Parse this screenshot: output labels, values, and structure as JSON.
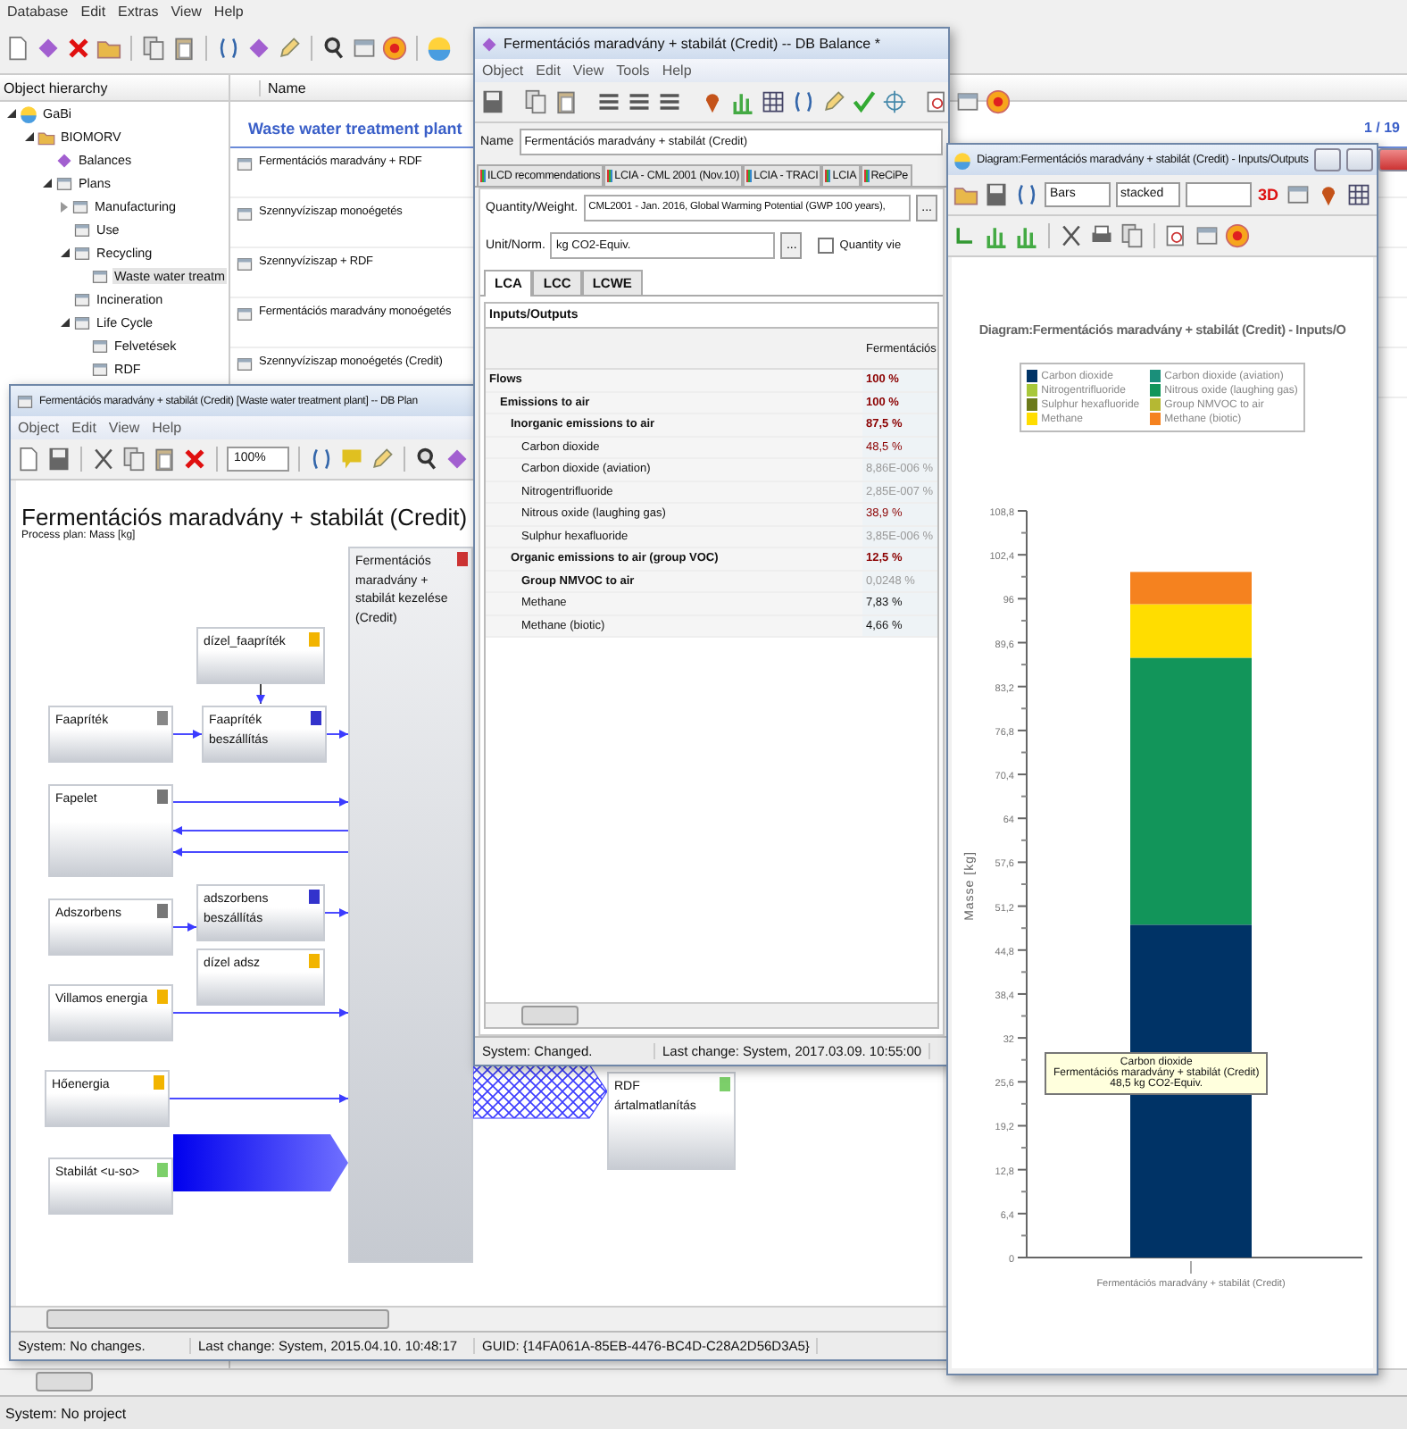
{
  "main": {
    "menu": [
      "Database",
      "Edit",
      "Extras",
      "View",
      "Help"
    ],
    "hierarchy_header": "Object hierarchy",
    "tree": [
      {
        "label": "GaBi",
        "kind": "root",
        "expanded": true,
        "selected": false,
        "children": [
          {
            "label": "BIOMORV",
            "kind": "database",
            "expanded": true,
            "selected": false,
            "children": [
              {
                "label": "Balances",
                "kind": "balance",
                "selected": false
              },
              {
                "label": "Plans",
                "kind": "plan",
                "expanded": true,
                "selected": false,
                "children": [
                  {
                    "label": "Manufacturing",
                    "kind": "plan",
                    "expanded": false,
                    "selected": false
                  },
                  {
                    "label": "Use",
                    "kind": "plan",
                    "selected": false
                  },
                  {
                    "label": "Recycling",
                    "kind": "plan",
                    "expanded": true,
                    "selected": false,
                    "children": [
                      {
                        "label": "Waste water treatm",
                        "kind": "plan",
                        "selected": true
                      }
                    ]
                  },
                  {
                    "label": "Incineration",
                    "kind": "plan",
                    "selected": false
                  },
                  {
                    "label": "Life Cycle",
                    "kind": "plan",
                    "expanded": true,
                    "selected": false,
                    "children": [
                      {
                        "label": "Felvetések",
                        "kind": "plan",
                        "selected": false
                      },
                      {
                        "label": "RDF",
                        "kind": "plan",
                        "selected": false
                      }
                    ]
                  }
                ]
              }
            ]
          }
        ]
      }
    ],
    "name_header": "Name",
    "group": "Waste water treatment plant",
    "page": "1 / 19",
    "items": [
      "Fermentációs maradvány + RDF",
      "Szennyvíziszap monoégetés",
      "Szennyvíziszap + RDF",
      "Fermentációs maradvány monoégetés",
      "Szennyvíziszap monoégetés (Credit)"
    ],
    "status": "System: No project"
  },
  "plan": {
    "title": "Fermentációs maradvány + stabilát (Credit) [Waste water treatment plant] -- DB Plan",
    "menu": [
      "Object",
      "Edit",
      "View",
      "Help"
    ],
    "zoom": "100%",
    "heading": "Fermentációs maradvány + stabilát (Credit)",
    "subheading": "Process plan: Mass [kg]",
    "nodes": [
      {
        "label": "dízel_faapríték",
        "kind": "process"
      },
      {
        "label": "Faapríték",
        "kind": "link"
      },
      {
        "label": "Faapríték beszállítás",
        "kind": "partner"
      },
      {
        "label": "Fapelet",
        "kind": "plan"
      },
      {
        "label": "Adszorbens",
        "kind": "plan"
      },
      {
        "label": "adszorbens beszállítás",
        "kind": "partner"
      },
      {
        "label": "dízel adsz",
        "kind": "process"
      },
      {
        "label": "Villamos energia",
        "kind": "process"
      },
      {
        "label": "Hőenergia",
        "kind": "process"
      },
      {
        "label": "Stabilát <u-so>",
        "kind": "output"
      },
      {
        "label": "Fermentációs maradvány + stabilát kezelése (Credit)",
        "kind": "main"
      },
      {
        "label": "RDF ártalmatlanítás",
        "kind": "output"
      }
    ],
    "status": [
      "System: No changes.",
      "Last change: System, 2015.04.10. 10:48:17",
      "GUID: {14FA061A-85EB-4476-BC4D-C28A2D56D3A5}"
    ]
  },
  "balance": {
    "title": "Fermentációs maradvány + stabilát (Credit) -- DB Balance *",
    "menu": [
      "Object",
      "Edit",
      "View",
      "Tools",
      "Help"
    ],
    "name_label": "Name",
    "name_value": "Fermentációs maradvány + stabilát (Credit)",
    "tabs": [
      {
        "label": "ILCD recommendations",
        "selected": false
      },
      {
        "label": "LCIA - CML 2001 (Nov.10)",
        "selected": false
      },
      {
        "label": "LCIA - TRACI",
        "selected": false
      },
      {
        "label": "LCIA",
        "selected": false
      },
      {
        "label": "ReCiPe",
        "selected": false
      }
    ],
    "quantity_label": "Quantity/Weight.",
    "quantity_value": "CML2001 - Jan. 2016, Global Warming Potential (GWP 100 years),",
    "quantity_browse": "...",
    "quantity_view": {
      "label": "Quantity vie",
      "checked": false
    },
    "unit_label": "Unit/Norm.",
    "unit_value": "kg CO2-Equiv.",
    "unit_browse": "...",
    "subtabs": [
      {
        "label": "LCA",
        "selected": true
      },
      {
        "label": "LCC",
        "selected": false
      },
      {
        "label": "LCWE",
        "selected": false
      }
    ],
    "section": "Inputs/Outputs",
    "column": "Fermentációs",
    "rows": [
      {
        "label": "Flows",
        "kind": "group",
        "value": "100 %",
        "color": "#8b0000",
        "children": [
          {
            "label": "Emissions to air",
            "kind": "group",
            "value": "100 %",
            "color": "#8b0000",
            "children": [
              {
                "label": "Inorganic emissions to air",
                "kind": "group",
                "value": "87,5 %",
                "color": "#8b0000",
                "children": [
                  {
                    "label": "Carbon dioxide",
                    "kind": "flow",
                    "value": "48,5 %",
                    "color": "#8b0000"
                  },
                  {
                    "label": "Carbon dioxide (aviation)",
                    "kind": "flow",
                    "value": "8,86E-006 %",
                    "color": "#9a9a9a"
                  },
                  {
                    "label": "Nitrogentrifluoride",
                    "kind": "flow",
                    "value": "2,85E-007 %",
                    "color": "#9a9a9a"
                  },
                  {
                    "label": "Nitrous oxide (laughing gas)",
                    "kind": "flow",
                    "value": "38,9 %",
                    "color": "#8b0000"
                  },
                  {
                    "label": "Sulphur hexafluoride",
                    "kind": "flow",
                    "value": "3,85E-006 %",
                    "color": "#9a9a9a"
                  }
                ]
              },
              {
                "label": "Organic emissions to air (group VOC)",
                "kind": "group",
                "value": "12,5 %",
                "color": "#8b0000",
                "children": [
                  {
                    "label": "Group NMVOC to air",
                    "kind": "group",
                    "value": "0,0248 %",
                    "color": "#9a9a9a"
                  },
                  {
                    "label": "Methane",
                    "kind": "flow",
                    "value": "7,83 %",
                    "color": "#111111"
                  },
                  {
                    "label": "Methane (biotic)",
                    "kind": "flow",
                    "value": "4,66 %",
                    "color": "#111111"
                  }
                ]
              }
            ]
          }
        ]
      }
    ],
    "status": [
      "System: Changed.",
      "Last change: System, 2017.03.09. 10:55:00"
    ]
  },
  "diagram": {
    "title": "Diagram:Fermentációs maradvány + stabilát (Credit) - Inputs/Outputs",
    "chart_kind": "Bars",
    "mode": "stacked",
    "label_3d": "3D",
    "chart_data": {
      "type": "bar",
      "stacked": true,
      "legend": "top",
      "title": "Diagram:Fermentációs maradvány + stabilát (Credit) - Inputs/O",
      "ylabel": "Masse [kg]",
      "categories": [
        "Fermentációs maradvány + stabilát (Credit)"
      ],
      "series": [
        {
          "name": "Carbon dioxide",
          "color": "#003366",
          "values": [
            48.5
          ]
        },
        {
          "name": "Carbon dioxide (aviation)",
          "color": "#1a8f7a",
          "values": [
            0
          ]
        },
        {
          "name": "Nitrogentrifluoride",
          "color": "#a8c83a",
          "values": [
            0
          ]
        },
        {
          "name": "Nitrous oxide (laughing gas)",
          "color": "#12955a",
          "values": [
            38.9
          ]
        },
        {
          "name": "Sulphur hexafluoride",
          "color": "#6b7a1a",
          "values": [
            0
          ]
        },
        {
          "name": "Group NMVOC to air",
          "color": "#b5b833",
          "values": [
            0
          ]
        },
        {
          "name": "Methane",
          "color": "#ffdd00",
          "values": [
            7.8
          ]
        },
        {
          "name": "Methane (biotic)",
          "color": "#f5821f",
          "values": [
            4.7
          ]
        }
      ],
      "ylim": [
        0,
        108.8
      ],
      "yticks": [
        0,
        {
          "value": 6.4,
          "label": "6,4"
        },
        {
          "value": 12.8,
          "label": "12,8"
        },
        {
          "value": 19.2,
          "label": "19,2"
        },
        {
          "value": 25.6,
          "label": "25,6"
        },
        32,
        {
          "value": 38.4,
          "label": "38,4"
        },
        {
          "value": 44.8,
          "label": "44,8"
        },
        {
          "value": 51.2,
          "label": "51,2"
        },
        {
          "value": 57.6,
          "label": "57,6"
        },
        64,
        {
          "value": 70.4,
          "label": "70,4"
        },
        {
          "value": 76.8,
          "label": "76,8"
        },
        {
          "value": 83.2,
          "label": "83,2"
        },
        {
          "value": 89.6,
          "label": "89,6"
        },
        96,
        {
          "value": 102.4,
          "label": "102,4"
        },
        {
          "value": 108.8,
          "label": "108,8"
        }
      ]
    },
    "tooltip": [
      "Carbon dioxide",
      "Fermentációs maradvány + stabilát (Credit)",
      "48,5 kg CO2-Equiv."
    ]
  }
}
